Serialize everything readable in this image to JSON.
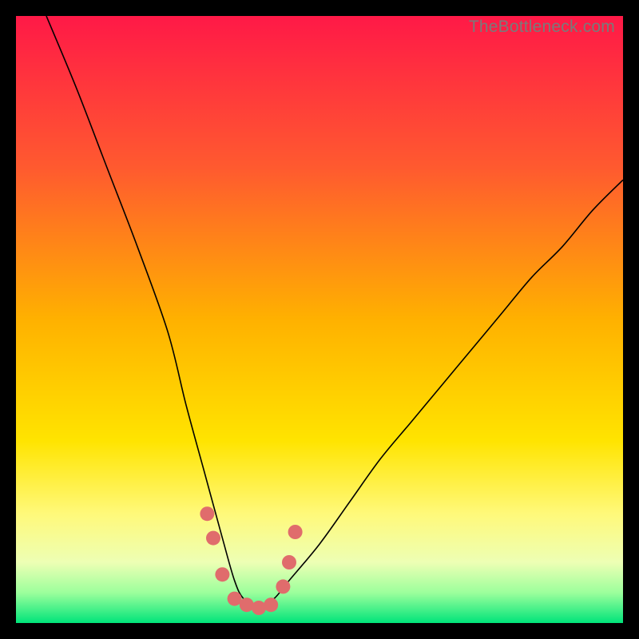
{
  "watermark": "TheBottleneck.com",
  "chart_data": {
    "type": "line",
    "title": "",
    "xlabel": "",
    "ylabel": "",
    "xlim": [
      0,
      100
    ],
    "ylim": [
      0,
      100
    ],
    "series": [
      {
        "name": "bottleneck-curve",
        "x": [
          5,
          10,
          15,
          20,
          25,
          28,
          31,
          34,
          36,
          37.5,
          40,
          42.5,
          45,
          50,
          55,
          60,
          65,
          70,
          75,
          80,
          85,
          90,
          95,
          100
        ],
        "values": [
          100,
          88,
          75,
          62,
          48,
          36,
          25,
          14,
          7,
          4,
          2.5,
          4,
          7,
          13,
          20,
          27,
          33,
          39,
          45,
          51,
          57,
          62,
          68,
          73
        ]
      }
    ],
    "markers": {
      "name": "highlight-dots",
      "color": "#e06c6c",
      "x": [
        31.5,
        32.5,
        34,
        36,
        38,
        40,
        42,
        44,
        45,
        46
      ],
      "values": [
        18,
        14,
        8,
        4,
        3,
        2.5,
        3,
        6,
        10,
        15
      ]
    },
    "background_gradient": {
      "stops": [
        {
          "offset": 0.0,
          "color": "#ff1947"
        },
        {
          "offset": 0.25,
          "color": "#ff5a2f"
        },
        {
          "offset": 0.5,
          "color": "#ffb100"
        },
        {
          "offset": 0.7,
          "color": "#ffe400"
        },
        {
          "offset": 0.82,
          "color": "#fff97a"
        },
        {
          "offset": 0.9,
          "color": "#edffb4"
        },
        {
          "offset": 0.95,
          "color": "#9cff9c"
        },
        {
          "offset": 1.0,
          "color": "#00e47a"
        }
      ]
    }
  }
}
